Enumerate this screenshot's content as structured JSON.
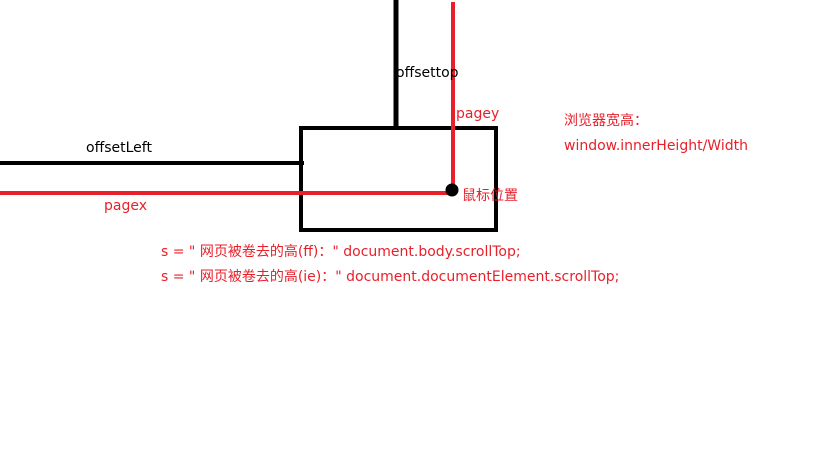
{
  "colors": {
    "black": "#000000",
    "red": "#e8202a",
    "background": "#ffffff"
  },
  "labels": {
    "offset_top": "offsettop",
    "offset_left": "offsetLeft",
    "page_y": "pagey",
    "page_x": "pagex",
    "mouse_position": "鼠标位置",
    "viewport_title": "浏览器宽高：",
    "viewport_value": "window.innerHeight/Width"
  },
  "code_lines": [
    "s = \" 网页被卷去的高(ff)：\" document.body.scrollTop;",
    "s = \" 网页被卷去的高(ie)：\" document.documentElement.scrollTop;"
  ]
}
